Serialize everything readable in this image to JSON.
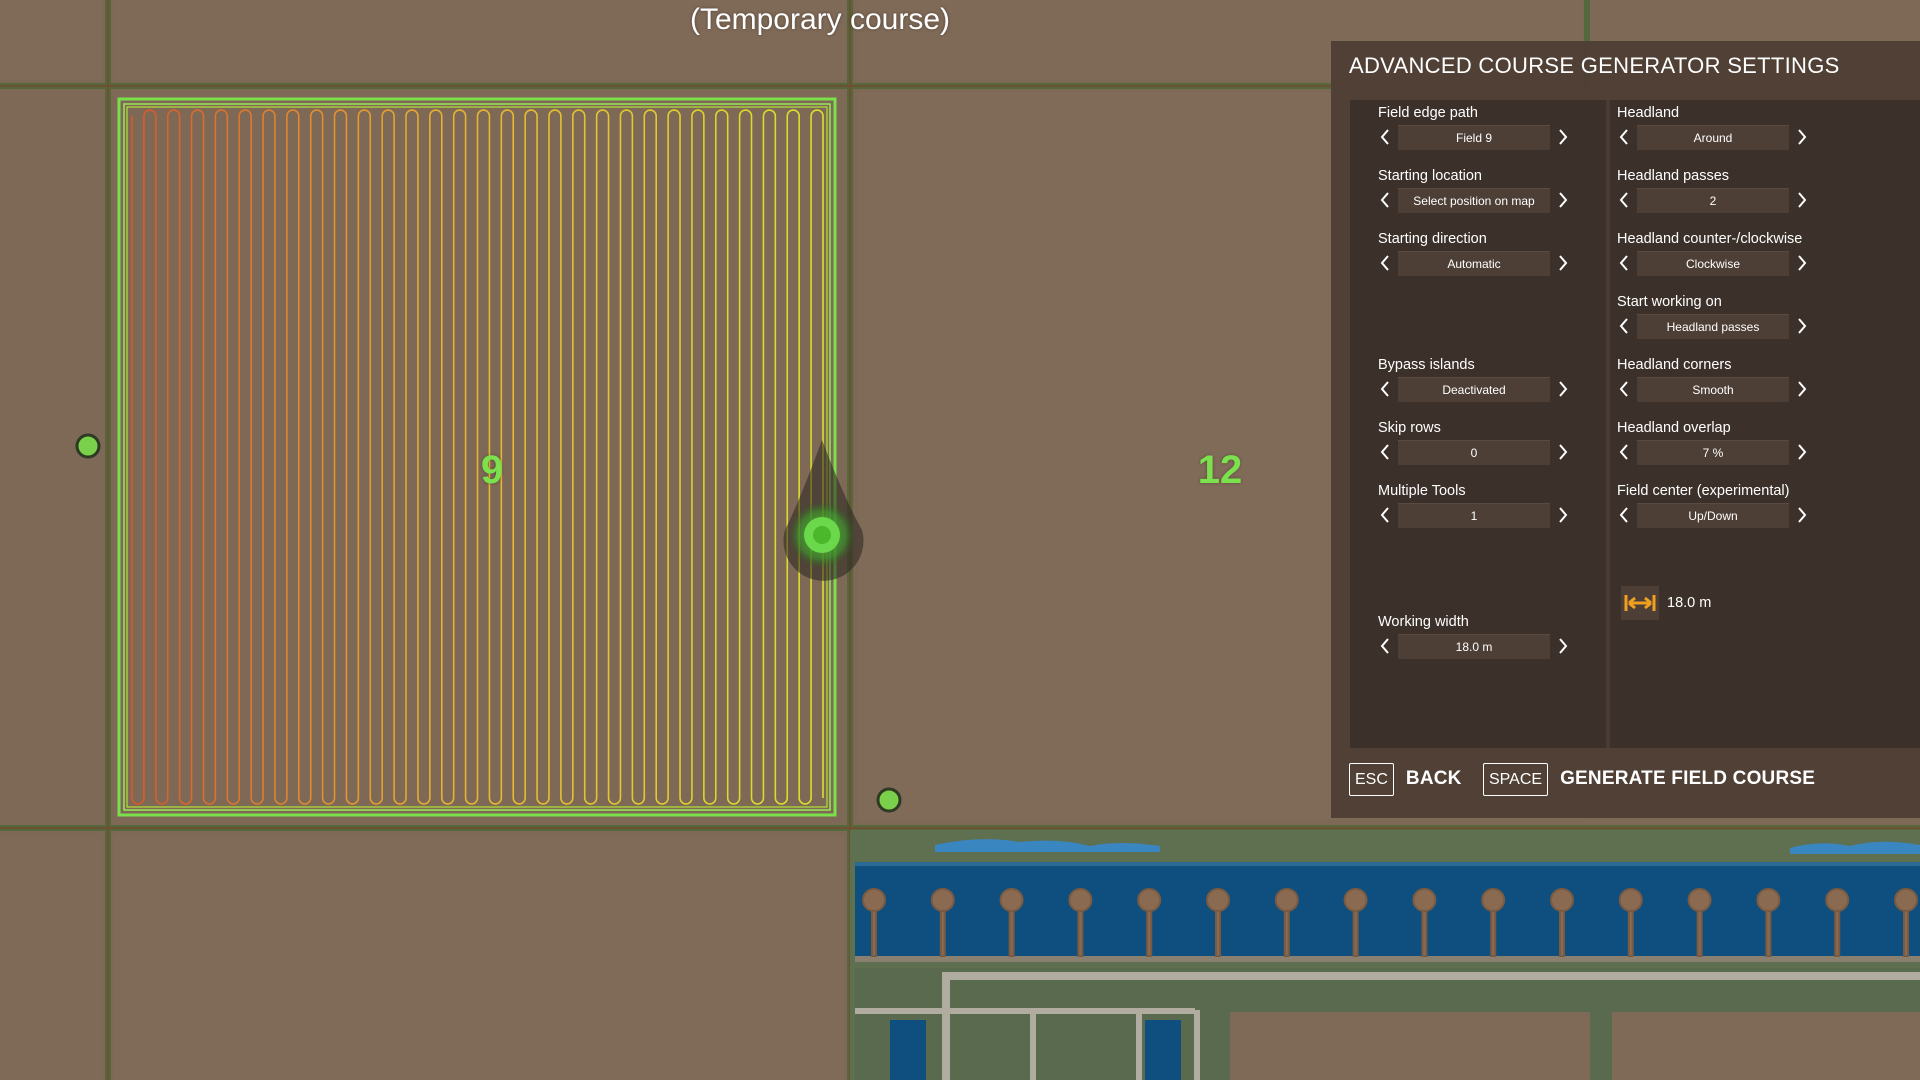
{
  "map": {
    "title": "(Temporary course)",
    "fields": [
      "9",
      "12"
    ]
  },
  "panel": {
    "title": "ADVANCED COURSE GENERATOR SETTINGS",
    "left": [
      {
        "label": "Field edge path",
        "value": "Field 9"
      },
      {
        "label": "Starting location",
        "value": "Select position on map"
      },
      {
        "label": "Starting direction",
        "value": "Automatic"
      },
      {
        "label": "Bypass islands",
        "value": "Deactivated"
      },
      {
        "label": "Skip rows",
        "value": "0"
      },
      {
        "label": "Multiple Tools",
        "value": "1"
      },
      {
        "label": "Working width",
        "value": "18.0 m"
      }
    ],
    "right": [
      {
        "label": "Headland",
        "value": "Around"
      },
      {
        "label": "Headland passes",
        "value": "2"
      },
      {
        "label": "Headland counter-/clockwise",
        "value": "Clockwise"
      },
      {
        "label": "Start working on",
        "value": "Headland passes"
      },
      {
        "label": "Headland corners",
        "value": "Smooth"
      },
      {
        "label": "Headland overlap",
        "value": "7 %"
      },
      {
        "label": "Field center (experimental)",
        "value": "Up/Down"
      }
    ],
    "width_readout": "18.0 m",
    "width_icon": "width-arrows-icon"
  },
  "footer": {
    "back": {
      "key": "ESC",
      "label": "BACK"
    },
    "generate": {
      "key": "SPACE",
      "label": "GENERATE FIELD COURSE"
    }
  },
  "colors": {
    "field_border": "#7ce04a",
    "path_start": "#d65a2c",
    "path_end": "#d9e22c",
    "accent": "#f0a020",
    "marker": "#7ad04a"
  }
}
